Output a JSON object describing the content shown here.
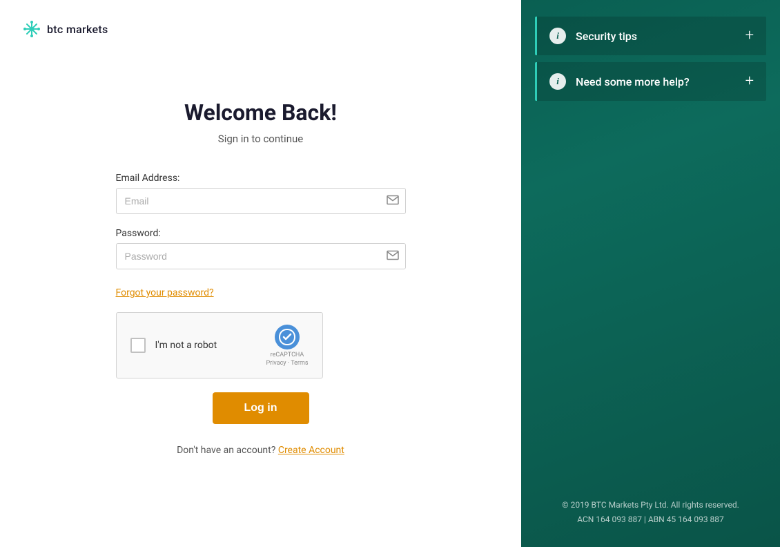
{
  "brand": {
    "name": "btc markets",
    "logo_alt": "BTC Markets logo"
  },
  "login_form": {
    "title": "Welcome Back!",
    "subtitle": "Sign in to continue",
    "email_label": "Email Address:",
    "email_placeholder": "Email",
    "password_label": "Password:",
    "password_placeholder": "Password",
    "forgot_password": "Forgot your password?",
    "recaptcha_label": "I'm not a robot",
    "recaptcha_sub1": "reCAPTCHA",
    "recaptcha_sub2": "Privacy · Terms",
    "login_button": "Log in",
    "signup_text": "Don't have an account?",
    "signup_link": "Create Account"
  },
  "sidebar": {
    "security_tips_label": "Security tips",
    "need_help_label": "Need some more help?"
  },
  "footer": {
    "line1": "© 2019 BTC Markets Pty Ltd. All rights reserved.",
    "line2": "ACN 164 093 887 | ABN 45 164 093 887"
  }
}
